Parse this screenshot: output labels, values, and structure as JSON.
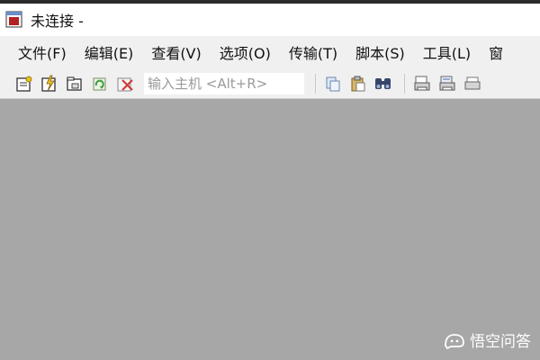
{
  "window": {
    "title": "未连接 -"
  },
  "menu": {
    "items": [
      {
        "label": "文件(F)"
      },
      {
        "label": "编辑(E)"
      },
      {
        "label": "查看(V)"
      },
      {
        "label": "选项(O)"
      },
      {
        "label": "传输(T)"
      },
      {
        "label": "脚本(S)"
      },
      {
        "label": "工具(L)"
      },
      {
        "label": "窗"
      }
    ]
  },
  "toolbar": {
    "host_input_placeholder": "输入主机 <Alt+R>",
    "icons": [
      "connect-icon",
      "quick-connect-icon",
      "connect-in-tab-icon",
      "reconnect-icon",
      "disconnect-icon",
      "copy-icon",
      "paste-icon",
      "find-icon",
      "print-setup-icon",
      "print-selection-icon",
      "print-icon"
    ]
  },
  "watermark": {
    "text": "悟空问答"
  },
  "colors": {
    "workspace": "#a7a7a7",
    "menubar": "#f0f0f0",
    "titlebar": "#ffffff"
  }
}
